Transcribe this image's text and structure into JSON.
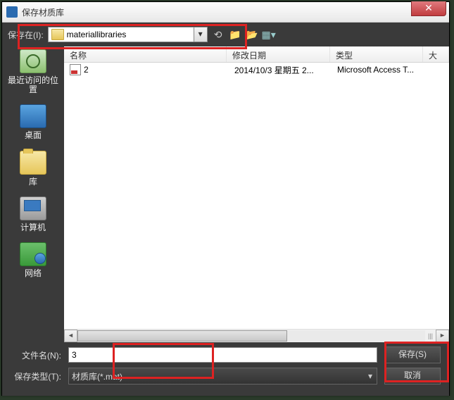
{
  "title": "保存材质库",
  "toolbar": {
    "save_in_label": "保存在(I):",
    "path": "materiallibraries"
  },
  "columns": {
    "name": "名称",
    "date": "修改日期",
    "type": "类型",
    "size": "大"
  },
  "places": {
    "recent": "最近访问的位置",
    "desktop": "桌面",
    "libraries": "库",
    "computer": "计算机",
    "network": "网络"
  },
  "files": [
    {
      "name": "2",
      "date": "2014/10/3 星期五 2...",
      "type": "Microsoft Access T..."
    }
  ],
  "scroll_mid": "|||",
  "bottom": {
    "filename_label": "文件名(N):",
    "filename_value": "3",
    "filetype_label": "保存类型(T):",
    "filetype_value": "材质库(*.mat)",
    "save": "保存(S)",
    "cancel": "取消"
  }
}
